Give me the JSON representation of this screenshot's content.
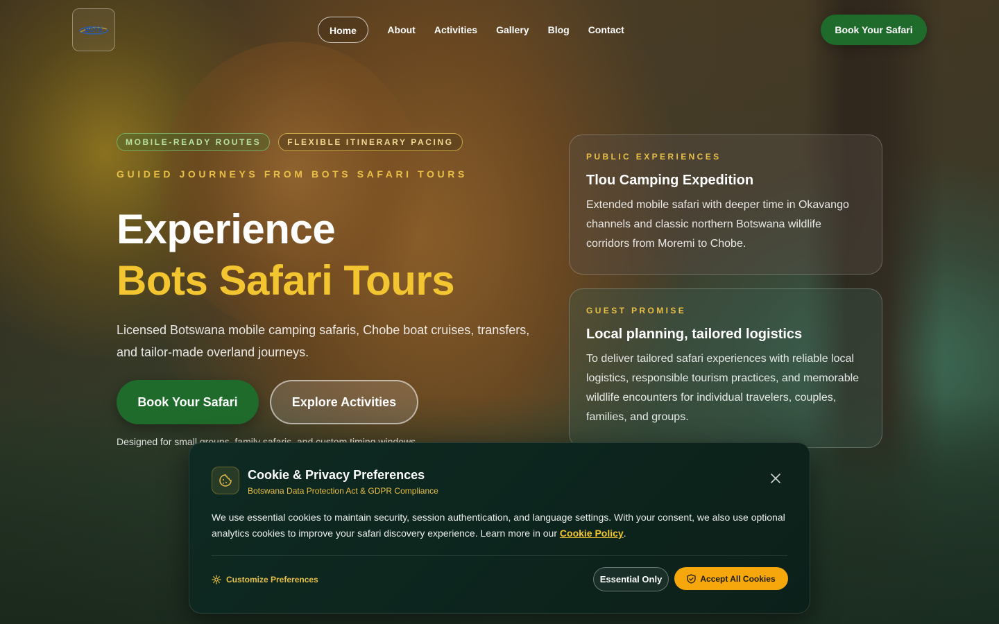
{
  "header": {
    "logo_text": "BOTS",
    "nav": [
      "Home",
      "About",
      "Activities",
      "Gallery",
      "Blog",
      "Contact"
    ],
    "active_nav": "Home",
    "cta": "Book Your Safari"
  },
  "hero": {
    "tags": [
      "MOBILE-READY ROUTES",
      "FLEXIBLE ITINERARY PACING"
    ],
    "eyebrow": "GUIDED JOURNEYS FROM BOTS SAFARI TOURS",
    "title_line1": "Experience",
    "title_line2": "Bots Safari Tours",
    "lead": "Licensed Botswana mobile camping safaris, Chobe boat cruises, transfers, and tailor-made overland journeys.",
    "primary_button": "Book Your Safari",
    "secondary_button": "Explore Activities",
    "note": "Designed for small groups, family safaris, and custom timing windows."
  },
  "cards": [
    {
      "eyebrow": "PUBLIC EXPERIENCES",
      "title": "Tlou Camping Expedition",
      "text": "Extended mobile safari with deeper time in Okavango channels and classic northern Botswana wildlife corridors from Moremi to Chobe."
    },
    {
      "eyebrow": "GUEST PROMISE",
      "title": "Local planning, tailored logistics",
      "text": "To deliver tailored safari experiences with reliable local logistics, responsible tourism practices, and memorable wildlife encounters for individual travelers, couples, families, and groups."
    }
  ],
  "cookie": {
    "title": "Cookie & Privacy Preferences",
    "subtitle": "Botswana Data Protection Act & GDPR Compliance",
    "body": "We use essential cookies to maintain security, session authentication, and language settings. With your consent, we also use optional analytics cookies to improve your safari discovery experience. Learn more in our ",
    "link": "Cookie Policy",
    "body_end": ".",
    "customize": "Customize Preferences",
    "essential": "Essential Only",
    "accept": "Accept All Cookies"
  },
  "colors": {
    "brand_green": "#1f6b2c",
    "accent_gold": "#f3c531",
    "accept_orange": "#f5a70c",
    "banner_bg": "#0e2a22"
  },
  "icons": [
    "cookie-icon",
    "close-icon",
    "gear-icon",
    "shield-check-icon"
  ]
}
